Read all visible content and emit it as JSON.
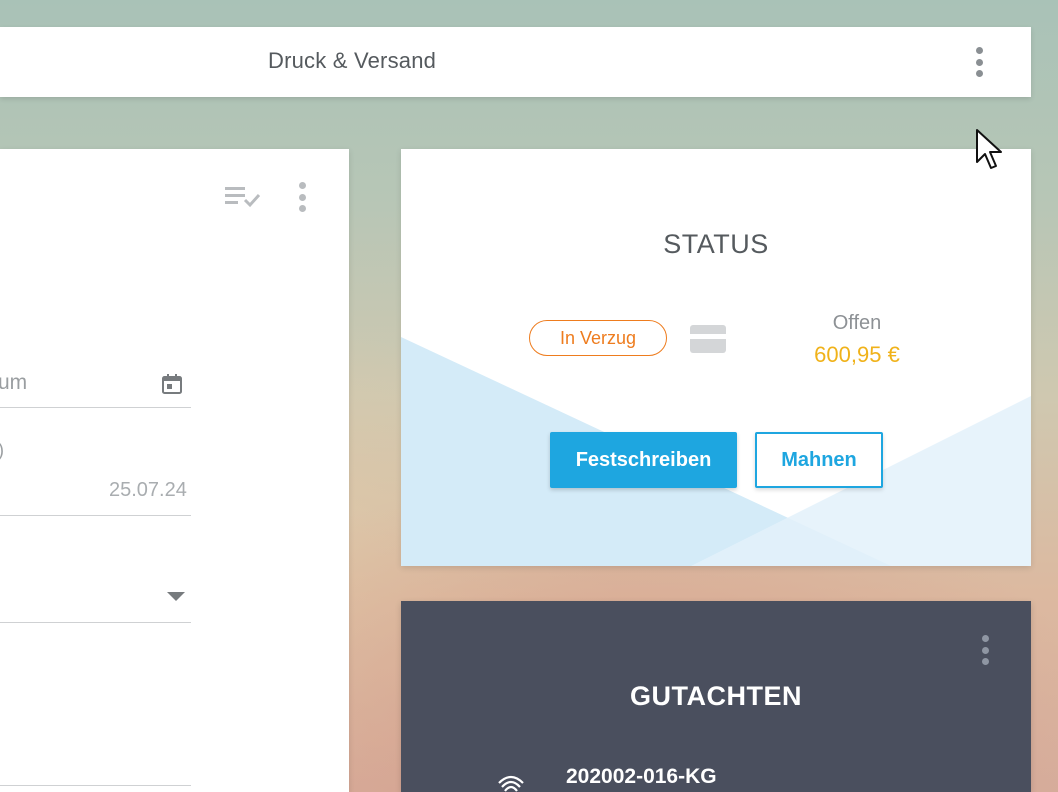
{
  "header": {
    "title": "Druck & Versand",
    "menu_icon": "more-vert-icon"
  },
  "form": {
    "date_field_label_fragment": "um",
    "date_field_icon": "calendar-icon",
    "second_field_label_fragment": ")",
    "second_field_value": "25.07.24",
    "select_icon": "dropdown-arrow-icon",
    "toolbar_icon": "checklist-icon"
  },
  "status": {
    "title": "STATUS",
    "badge": "In Verzug",
    "payment_icon": "credit-card-icon",
    "open_label": "Offen",
    "open_amount": "600,95 €",
    "buttons": {
      "finalize": "Festschreiben",
      "remind": "Mahnen"
    }
  },
  "gutachten": {
    "title": "GUTACHTEN",
    "report_icon": "fingerprint-icon",
    "report_number": "202002-016-KG"
  },
  "colors": {
    "accent": "#1ea6e0",
    "badge_orange": "#ee7c1e",
    "amount_yellow": "#f0b21a",
    "dark_card": "#4a4f5e"
  }
}
